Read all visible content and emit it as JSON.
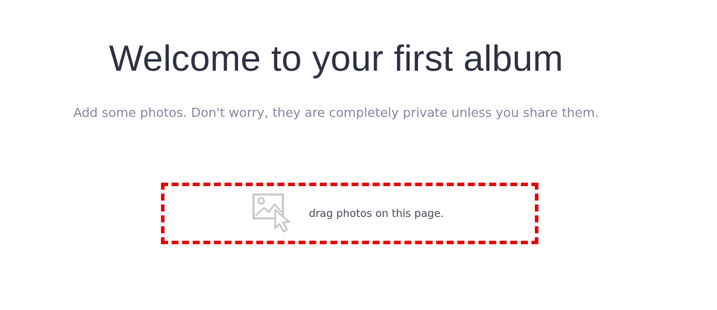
{
  "header": {
    "title": "Welcome to your first album",
    "subtitle": "Add some photos. Don't worry, they are completely private unless you share them."
  },
  "dropzone": {
    "icon": "drag-photo-icon",
    "hint": "drag photos on this page.",
    "border_color": "#e60000"
  },
  "colors": {
    "title": "#2f3243",
    "subtitle": "#858aa0",
    "icon": "#c8c8cc"
  }
}
